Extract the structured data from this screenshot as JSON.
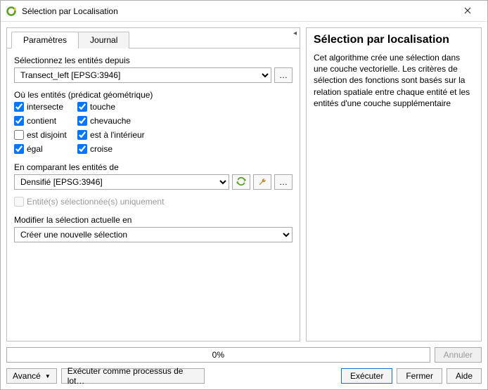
{
  "window": {
    "title": "Sélection par Localisation"
  },
  "tabs": {
    "parameters": "Paramètres",
    "log": "Journal"
  },
  "labels": {
    "select_from": "Sélectionnez les entités depuis",
    "predicate_header": "Où les entités (prédicat géométrique)",
    "compare_to": "En comparant les entités de",
    "selected_only": "Entité(s) sélectionnée(s) uniquement",
    "modify_selection": "Modifier la sélection actuelle en"
  },
  "layers": {
    "input": "Transect_left [EPSG:3946]",
    "compare": "Densifié [EPSG:3946]"
  },
  "predicates": {
    "intersects": {
      "label": "intersecte",
      "checked": true
    },
    "touches": {
      "label": "touche",
      "checked": true
    },
    "contains": {
      "label": "contient",
      "checked": true
    },
    "overlaps": {
      "label": "chevauche",
      "checked": true
    },
    "disjoint": {
      "label": "est disjoint",
      "checked": false
    },
    "within": {
      "label": "est à l'intérieur",
      "checked": true
    },
    "equals": {
      "label": "égal",
      "checked": true
    },
    "crosses": {
      "label": "croise",
      "checked": true
    }
  },
  "modify_option": "Créer une nouvelle sélection",
  "progress": {
    "percent_label": "0%"
  },
  "buttons": {
    "cancel_run": "Annuler",
    "advanced": "Avancé",
    "batch": "Exécuter comme processus de lot…",
    "run": "Exécuter",
    "close": "Fermer",
    "help": "Aide",
    "browse": "…"
  },
  "help": {
    "title": "Sélection par localisation",
    "body": "Cet algorithme crée une sélection dans une couche vectorielle. Les critères de sélection des fonctions sont basés sur la relation spatiale entre chaque entité et les entités d'une couche supplémentaire"
  },
  "colors": {
    "accent": "#1a6fc4",
    "iterate_green": "#5aa02c",
    "wrench": "#b58a2d",
    "app_green": "#5a9e1f"
  }
}
